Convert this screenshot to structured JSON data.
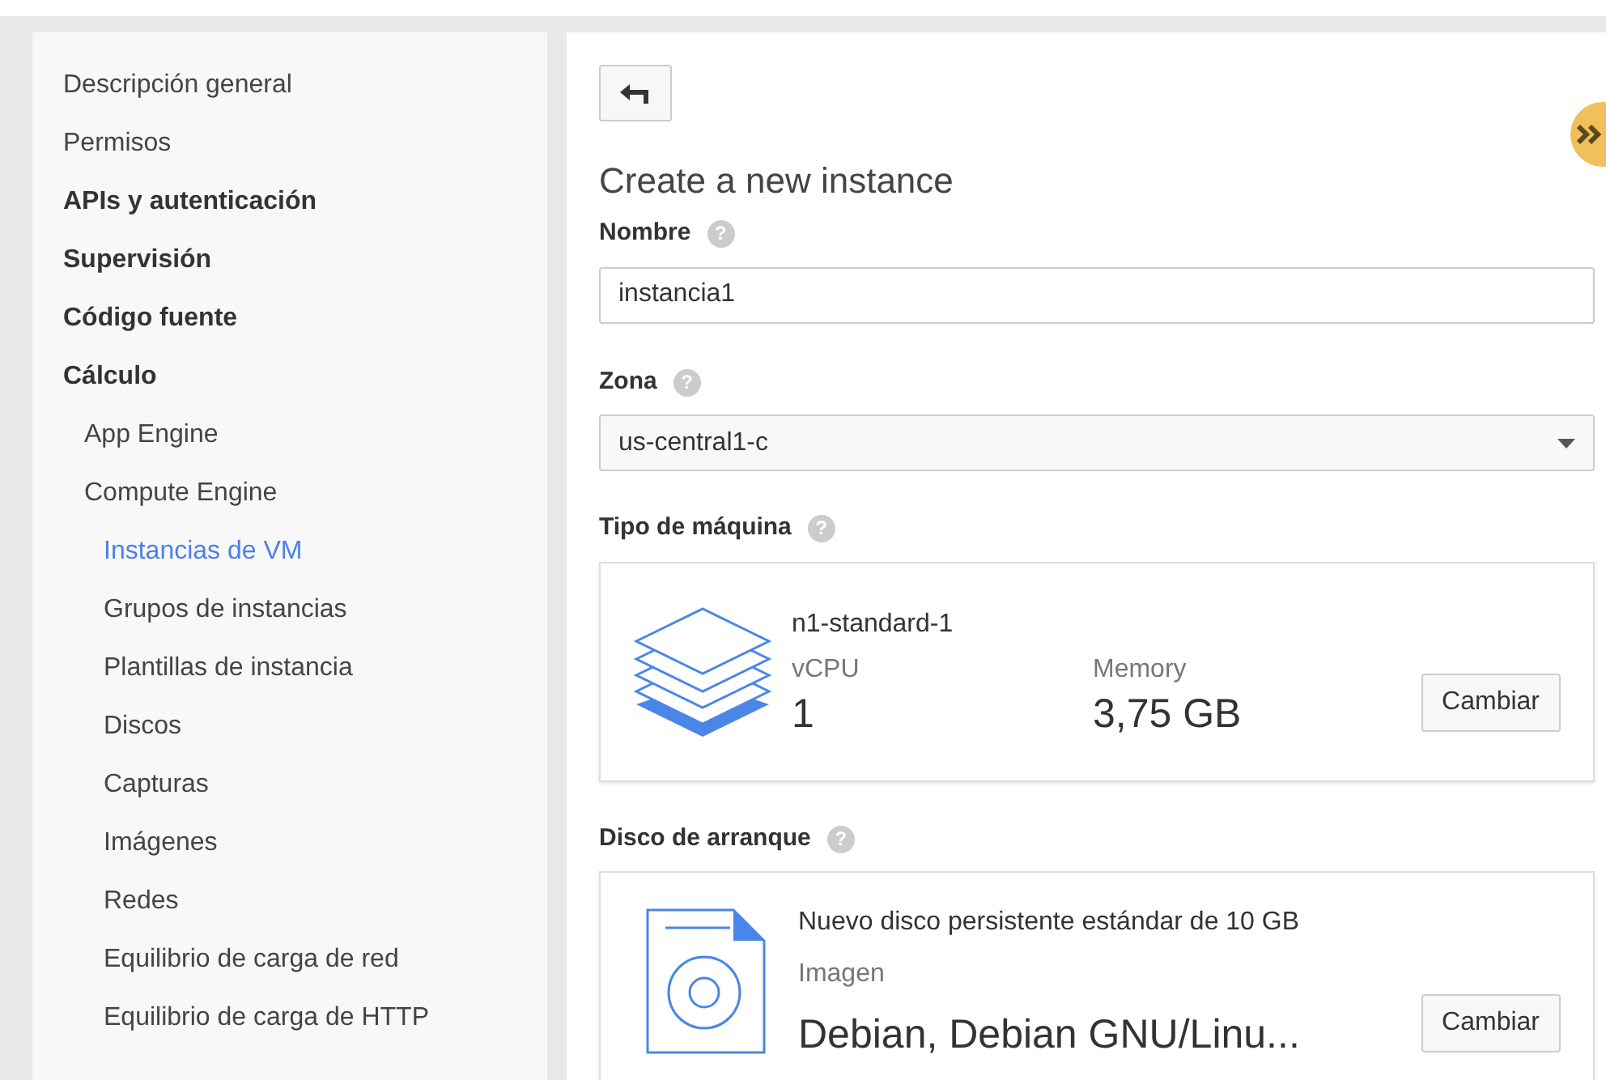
{
  "sidebar": {
    "items": [
      {
        "label": "Descripción general",
        "kind": "link",
        "selected": false
      },
      {
        "label": "Permisos",
        "kind": "link",
        "selected": false
      },
      {
        "label": "APIs y autenticación",
        "kind": "section",
        "selected": false
      },
      {
        "label": "Supervisión",
        "kind": "section",
        "selected": false
      },
      {
        "label": "Código fuente",
        "kind": "section",
        "selected": false
      },
      {
        "label": "Cálculo",
        "kind": "section",
        "selected": false,
        "children": [
          {
            "label": "App Engine",
            "kind": "link",
            "selected": false
          },
          {
            "label": "Compute Engine",
            "kind": "link",
            "selected": false,
            "children": [
              {
                "label": "Instancias de VM",
                "kind": "link",
                "selected": true
              },
              {
                "label": "Grupos de instancias",
                "kind": "link",
                "selected": false
              },
              {
                "label": "Plantillas de instancia",
                "kind": "link",
                "selected": false
              },
              {
                "label": "Discos",
                "kind": "link",
                "selected": false
              },
              {
                "label": "Capturas",
                "kind": "link",
                "selected": false
              },
              {
                "label": "Imágenes",
                "kind": "link",
                "selected": false
              },
              {
                "label": "Redes",
                "kind": "link",
                "selected": false
              },
              {
                "label": "Equilibrio de carga de red",
                "kind": "link",
                "selected": false
              },
              {
                "label": "Equilibrio de carga de HTTP",
                "kind": "link",
                "selected": false
              }
            ]
          }
        ]
      }
    ]
  },
  "form": {
    "title": "Create a new instance",
    "name_field": {
      "label": "Nombre",
      "help": "?",
      "value": "instancia1"
    },
    "zone_field": {
      "label": "Zona",
      "help": "?",
      "value": "us-central1-c"
    },
    "machine_type": {
      "label": "Tipo de máquina",
      "help": "?",
      "name": "n1-standard-1",
      "vcpu_label": "vCPU",
      "vcpu": "1",
      "memory_label": "Memory",
      "memory": "3,75 GB",
      "button": "Cambiar"
    },
    "boot_disk": {
      "label": "Disco de arranque",
      "help": "?",
      "description": "Nuevo disco persistente estándar de 10 GB",
      "image_label": "Imagen",
      "image": "Debian, Debian GNU/Linu...",
      "button": "Cambiar"
    }
  }
}
